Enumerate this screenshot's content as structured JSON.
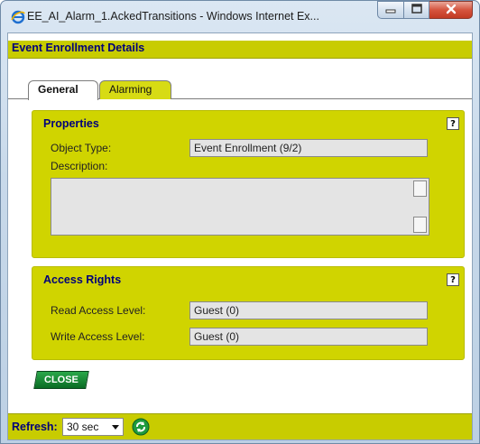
{
  "window": {
    "title": "EE_AI_Alarm_1.AckedTransitions - Windows Internet Ex...",
    "icons": {
      "app": "ie-icon",
      "minimize": "minimize-icon",
      "maximize": "maximize-icon",
      "close": "close-icon"
    }
  },
  "header": {
    "title": "Event Enrollment Details"
  },
  "tabs": [
    {
      "label": "General",
      "active": true
    },
    {
      "label": "Alarming",
      "active": false
    }
  ],
  "properties": {
    "title": "Properties",
    "help": "?",
    "object_type_label": "Object Type:",
    "object_type_value": "Event Enrollment (9/2)",
    "description_label": "Description:",
    "description_value": ""
  },
  "access_rights": {
    "title": "Access Rights",
    "help": "?",
    "read_label": "Read Access Level:",
    "read_value": "Guest (0)",
    "write_label": "Write Access Level:",
    "write_value": "Guest (0)"
  },
  "close_button": {
    "label": "CLOSE"
  },
  "refresh": {
    "label": "Refresh:",
    "selected": "30 sec",
    "icon": "refresh-icon"
  },
  "colors": {
    "accent": "#c8cc00",
    "panel": "#d0d400",
    "heading_text": "#00007a",
    "close_button": "#0a6c24"
  }
}
